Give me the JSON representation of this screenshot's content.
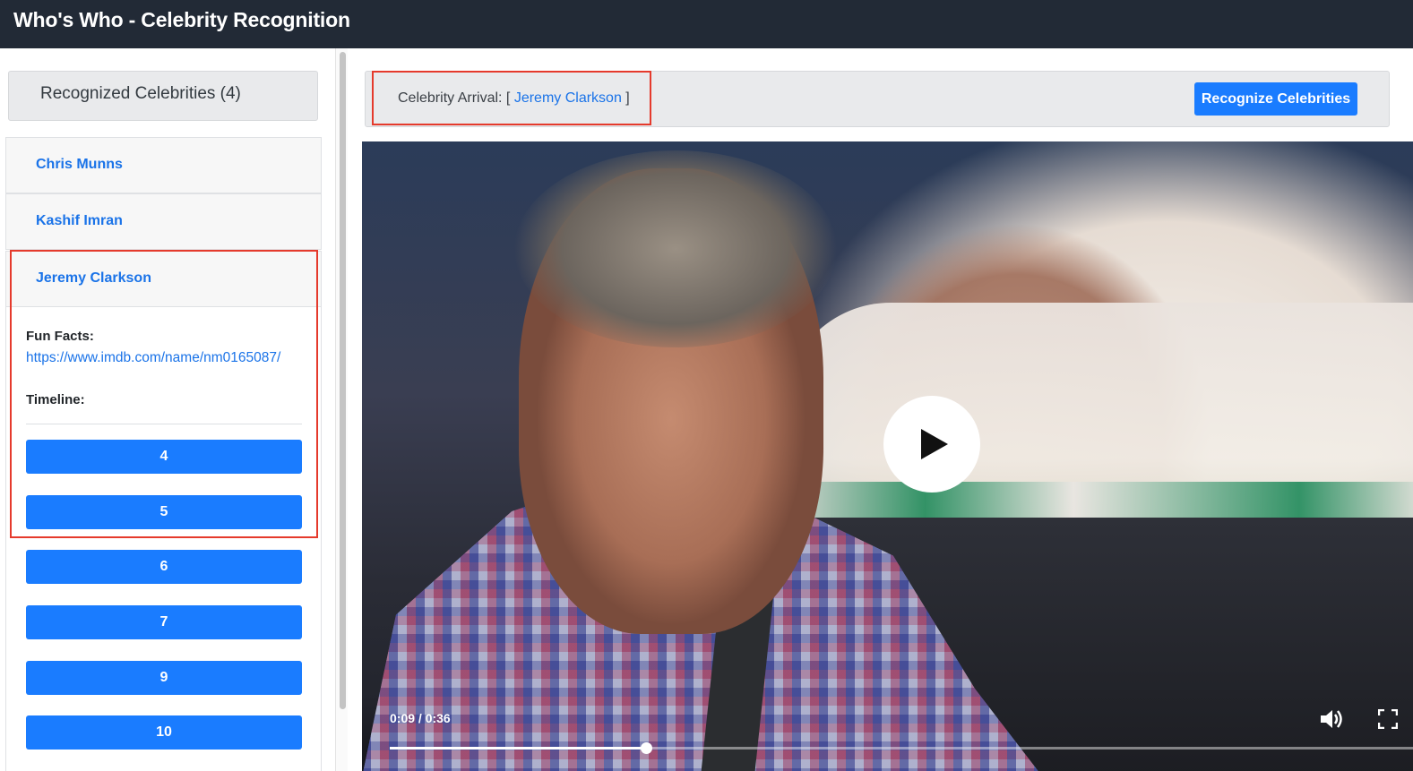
{
  "app": {
    "title": "Who's Who - Celebrity Recognition"
  },
  "sidebar": {
    "header": "Recognized Celebrities (4)",
    "items": [
      {
        "name": "Chris Munns"
      },
      {
        "name": "Kashif Imran"
      },
      {
        "name": "Jeremy Clarkson"
      }
    ],
    "expanded": {
      "fun_facts_label": "Fun Facts:",
      "fun_facts_link": "https://www.imdb.com/name/nm0165087/",
      "timeline_label": "Timeline:",
      "timeline": [
        "4",
        "5",
        "6",
        "7",
        "9",
        "10"
      ]
    }
  },
  "main": {
    "arrival_prefix": "Celebrity Arrival: [ ",
    "arrival_name": "Jeremy Clarkson",
    "arrival_suffix": " ]",
    "recognize_button": "Recognize Celebrities"
  },
  "video": {
    "time_display": "0:09 / 0:36",
    "progress_fraction": 0.25,
    "icons": {
      "play": "play-icon",
      "volume": "volume-icon",
      "fullscreen": "fullscreen-icon"
    }
  },
  "colors": {
    "accent": "#1a7cff",
    "link": "#1a73e8",
    "navbar": "#222a36",
    "highlight": "#e53a2c"
  }
}
